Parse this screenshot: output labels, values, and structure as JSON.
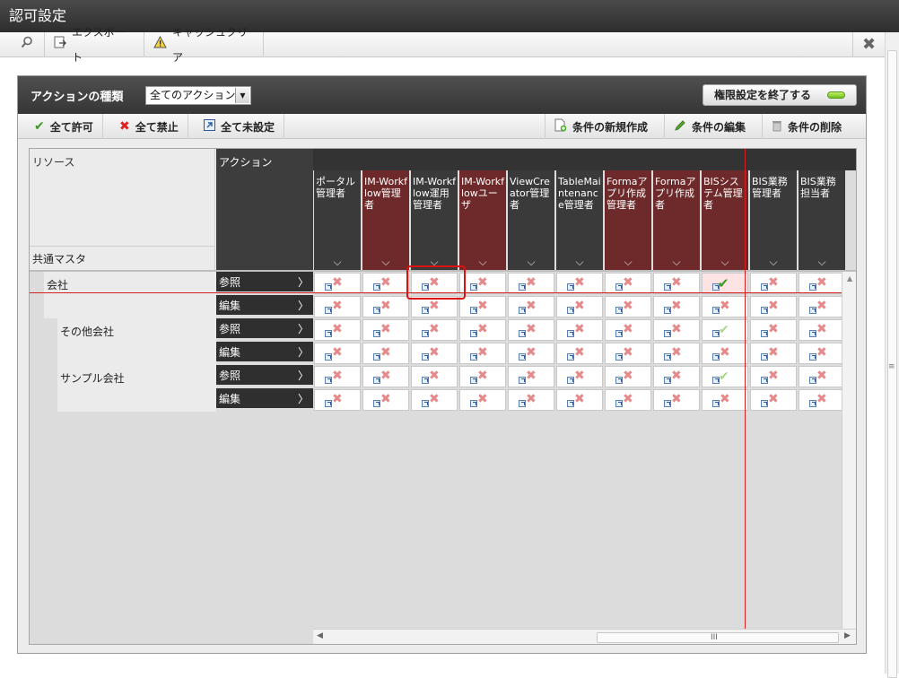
{
  "window": {
    "title": "認可設定"
  },
  "toolbar": {
    "export_label": "エクスポート",
    "cache_clear_label": "キャッシュクリア"
  },
  "panel": {
    "action_type_label": "アクションの種類",
    "action_type_value": "全てのアクション",
    "end_button_label": "権限設定を終了する",
    "allow_all": "全て許可",
    "deny_all": "全て禁止",
    "unset_all": "全て未設定",
    "new_condition": "条件の新規作成",
    "edit_condition": "条件の編集",
    "delete_condition": "条件の削除"
  },
  "grid": {
    "resource_header": "リソース",
    "action_header": "アクション",
    "master_label": "共通マスタ",
    "roles": [
      {
        "label": "ポータル管理者",
        "color": "dark"
      },
      {
        "label": "IM-Workflow管理者",
        "color": "red"
      },
      {
        "label": "IM-Workflow運用管理者",
        "color": "dark"
      },
      {
        "label": "IM-Workflowユーザ",
        "color": "red"
      },
      {
        "label": "ViewCreator管理者",
        "color": "dark"
      },
      {
        "label": "TableMaintenance管理者",
        "color": "dark"
      },
      {
        "label": "Formaアプリ作成管理者",
        "color": "red"
      },
      {
        "label": "Formaアプリ作成者",
        "color": "red"
      },
      {
        "label": "BISシステム管理者",
        "color": "red"
      },
      {
        "label": "BIS業務管理者",
        "color": "dark"
      },
      {
        "label": "BIS業務担当者",
        "color": "dark"
      }
    ],
    "resources": [
      {
        "name": "会社",
        "indent": 1
      },
      {
        "name": "その他会社",
        "indent": 2
      },
      {
        "name": "サンプル会社",
        "indent": 2
      }
    ],
    "actions": [
      "参照",
      "編集"
    ],
    "rows": [
      {
        "resource": 0,
        "action": 0,
        "cells": [
          "deny",
          "deny",
          "deny",
          "deny",
          "deny",
          "deny",
          "deny",
          "deny",
          "allow-selected",
          "deny",
          "deny"
        ]
      },
      {
        "resource": 0,
        "action": 1,
        "cells": [
          "deny",
          "deny",
          "deny",
          "deny",
          "deny",
          "deny",
          "deny",
          "deny",
          "deny",
          "deny",
          "deny"
        ]
      },
      {
        "resource": 1,
        "action": 0,
        "cells": [
          "deny",
          "deny",
          "deny",
          "deny",
          "deny",
          "deny",
          "deny",
          "deny",
          "allow-inherit",
          "deny",
          "deny"
        ]
      },
      {
        "resource": 1,
        "action": 1,
        "cells": [
          "deny",
          "deny",
          "deny",
          "deny",
          "deny",
          "deny",
          "deny",
          "deny",
          "deny",
          "deny",
          "deny"
        ]
      },
      {
        "resource": 2,
        "action": 0,
        "cells": [
          "deny",
          "deny",
          "deny",
          "deny",
          "deny",
          "deny",
          "deny",
          "deny",
          "allow-inherit",
          "deny",
          "deny"
        ]
      },
      {
        "resource": 2,
        "action": 1,
        "cells": [
          "deny",
          "deny",
          "deny",
          "deny",
          "deny",
          "deny",
          "deny",
          "deny",
          "deny",
          "deny",
          "deny"
        ]
      }
    ]
  },
  "scroll": {
    "h_indicator": "III",
    "v_indicator": "≡"
  }
}
